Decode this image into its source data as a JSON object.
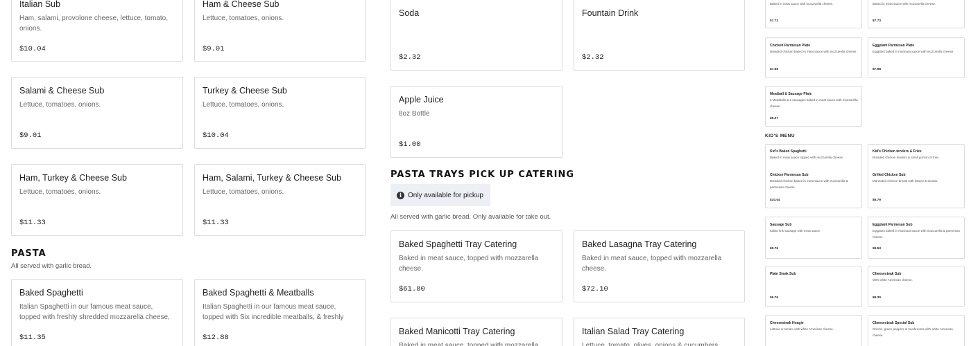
{
  "col1": [
    {
      "title": "Italian Sub",
      "desc": "Ham, salami, provolone cheese, lettuce, tomato, onions.",
      "price": "$10.04"
    },
    {
      "title": "Ham & Cheese Sub",
      "desc": "Lettuce, tomatoes, onions.",
      "price": "$9.01"
    },
    {
      "title": "Salami & Cheese Sub",
      "desc": "Lettuce, tomatoes, onions.",
      "price": "$9.01"
    },
    {
      "title": "Turkey & Cheese Sub",
      "desc": "Lettuce, tomatoes, onions.",
      "price": "$10.04"
    },
    {
      "title": "Ham, Turkey & Cheese Sub",
      "desc": "Lettuce, tomatoes, onions.",
      "price": "$11.33"
    },
    {
      "title": "Ham, Salami, Turkey & Cheese Sub",
      "desc": "Lettuce, tomatoes, onions.",
      "price": "$11.33"
    }
  ],
  "pasta": {
    "title": "PASTA",
    "subtitle": "All served with garlic bread.",
    "items": [
      {
        "title": "Baked Spaghetti",
        "desc": "Italian Spaghetti in our famous meat sauce, topped with freshly shredded mozzarella cheese,",
        "price": "$11.35"
      },
      {
        "title": "Baked Spaghetti & Meatballs",
        "desc": "Italian Spaghetti in our famous meat sauce, topped with Six incredible meatballs, & freshly",
        "price": "$12.88"
      }
    ]
  },
  "drinks": [
    {
      "title": "Soda",
      "desc": "",
      "price": "$2.32"
    },
    {
      "title": "Fountain Drink",
      "desc": "",
      "price": "$2.32"
    },
    {
      "title": "Apple Juice",
      "desc": "8oz Bottle",
      "price": "$1.00"
    }
  ],
  "catering": {
    "title": "PASTA TRAYS PICK UP CATERING",
    "notice": "Only available for pickup",
    "subtitle": "All served with garlic bread. Only available for take out.",
    "items": [
      {
        "title": "Baked Spaghetti Tray Catering",
        "desc": "Baked in meat sauce, topped with mozzarella cheese.",
        "price": "$61.80"
      },
      {
        "title": "Baked Lasagna Tray Catering",
        "desc": "Baked in meat sauce, topped with mozzarella cheese.",
        "price": "$72.10"
      },
      {
        "title": "Baked Manicotti Tray Catering",
        "desc": "Baked in meat sauce, topped with mozzarella",
        "price": ""
      },
      {
        "title": "Italian Salad Tray Catering",
        "desc": "Lettuce, tomato, olives, onions & cucumbers.",
        "price": ""
      }
    ]
  },
  "right": {
    "top": [
      {
        "title": "",
        "desc": "Baked in meat sauce with mozzarella cheese.",
        "price": "$7.73"
      },
      {
        "title": "",
        "desc": "Baked in meat sauce with mozzarella cheese.",
        "price": "$7.73"
      },
      {
        "title": "Chicken Parmesan Plate",
        "desc": "Breaded chicken baked in meat sauce with mozzarella cheese.",
        "price": "$7.98"
      },
      {
        "title": "Eggplant Parmesan Plate",
        "desc": "Eggplant baked in marinara sauce with mozzarella cheese.",
        "price": "$7.98"
      },
      {
        "title": "Meatball & Sausage Plate",
        "desc": "6 Meatballs & 6 sausages baked in meat sauce with mozzarella cheese.",
        "price": "$9.27"
      }
    ],
    "kids_header": "KID'S MENU",
    "kids": [
      {
        "title": "Kid's Baked Spaghetti",
        "desc": "Baked in meat sauce topped with mozzarella cheese.",
        "price": ""
      },
      {
        "title": "Kid's Chicken tenders & Fries",
        "desc": "Breaded chicken tenders & small portion of fries.",
        "price": ""
      },
      {
        "title": "Chicken Parmesan Sub",
        "desc": "Breaded chicken baked in meat sauce with mozzarella & parmesan cheese.",
        "price": "$10.04"
      },
      {
        "title": "Grilled Chicken Sub",
        "desc": "Marinated chicken breast with lettuce & tomato.",
        "price": "$9.79"
      },
      {
        "title": "Sausage Sub",
        "desc": "Italian link sausage with meat sauce.",
        "price": "$9.76"
      },
      {
        "title": "Eggplant Parmesan Sub",
        "desc": "Eggplant baked in marinara sauce with mozzarella & parmesan cheese.",
        "price": "$9.53"
      },
      {
        "title": "Plain Steak Sub",
        "desc": "",
        "price": "$9.76"
      },
      {
        "title": "Cheesesteak Sub",
        "desc": "With white American cheese.",
        "price": "$9.30"
      },
      {
        "title": "Cheesesteak Hoagie",
        "desc": "Lettuce & tomato with white American cheese.",
        "price": ""
      },
      {
        "title": "Cheesesteak Special Sub",
        "desc": "Onions, green peppers & mushrooms with white American cheese.",
        "price": ""
      }
    ]
  }
}
